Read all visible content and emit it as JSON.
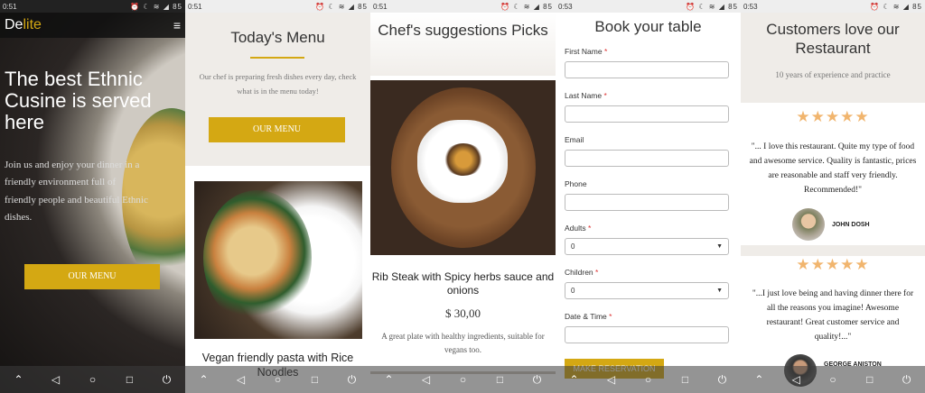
{
  "status": {
    "p1_time": "0:51",
    "p2_time": "0:51",
    "p3_time": "0:51",
    "p4_time": "0:53",
    "p5_time": "0:53",
    "icons": "⏰ ☾ ≋ ◢ 85",
    "p1_icons": "⏰ ☾ ≋ ◢ 85"
  },
  "home": {
    "logo_prefix": "De",
    "logo_accent": "lite",
    "hero_title": "The best Ethnic Cusine is served here",
    "hero_text": "Join us and enjoy your dinner in a friendly environment full of friendly people and beautiful Ethnic dishes.",
    "button": "OUR MENU"
  },
  "menu": {
    "title": "Today's Menu",
    "description": "Our chef is preparing fresh dishes every day, check what is in the menu today!",
    "button": "OUR MENU",
    "dish_name": "Vegan friendly pasta with Rice Noodles"
  },
  "suggestions": {
    "title": "Chef's suggestions Picks",
    "dish_name": "Rib Steak with Spicy herbs sauce and onions",
    "price": "$ 30,00",
    "description": "A great plate with healthy ingredients, suitable for vegans too."
  },
  "booking": {
    "title": "Book your table",
    "fields": [
      {
        "label": "First Name",
        "required": "*",
        "value": ""
      },
      {
        "label": "Last Name",
        "required": "*",
        "value": ""
      },
      {
        "label": "Email",
        "required": "",
        "value": ""
      },
      {
        "label": "Phone",
        "required": "",
        "value": ""
      },
      {
        "label": "Adults",
        "required": "*",
        "value": "0"
      },
      {
        "label": "Children",
        "required": "*",
        "value": "0"
      },
      {
        "label": "Date & Time",
        "required": "*",
        "value": ""
      }
    ],
    "button": "MAKE RESERVATION"
  },
  "testimonials": {
    "title": "Customers love our Restaurant",
    "subtitle": "10 years of experience and practice",
    "stars": "★★★★★",
    "reviews": [
      {
        "quote": "\"... I love this restaurant. Quite my type of food and awesome service. Quality is fantastic, prices are reasonable and staff very friendly. Recommended!\"",
        "name": "JOHN DOSH"
      },
      {
        "quote": "\"...I just love being and having dinner there for all the reasons you imagine! Awesome restaurant! Great customer service and quality!...\"",
        "name": "GEORGE ANISTON"
      }
    ]
  },
  "navbar": {
    "up": "⌃",
    "back": "◁",
    "home": "○",
    "recent": "□",
    "power": "⏻"
  },
  "colors": {
    "accent": "#d4a813",
    "star": "#f1b56e"
  }
}
